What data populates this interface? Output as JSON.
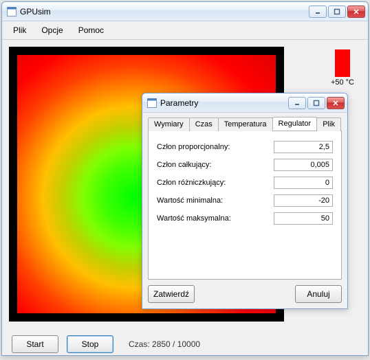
{
  "main_window": {
    "title": "GPUsim",
    "menu": {
      "file": "Plik",
      "options": "Opcje",
      "help": "Pomoc"
    },
    "legend_top": "+50 °C",
    "buttons": {
      "start": "Start",
      "stop": "Stop"
    },
    "status_prefix": "Czas: ",
    "status_value": "2850 / 10000"
  },
  "dialog": {
    "title": "Parametry",
    "tabs": {
      "dims": "Wymiary",
      "time": "Czas",
      "temp": "Temperatura",
      "reg": "Regulator",
      "file": "Plik"
    },
    "selected_tab": "reg",
    "fields": [
      {
        "label": "Człon proporcjonalny:",
        "value": "2,5"
      },
      {
        "label": "Człon całkujący:",
        "value": "0,005"
      },
      {
        "label": "Człon różniczkujący:",
        "value": "0"
      },
      {
        "label": "Wartość minimalna:",
        "value": "-20"
      },
      {
        "label": "Wartość maksymalna:",
        "value": "50"
      }
    ],
    "buttons": {
      "ok": "Zatwierdź",
      "cancel": "Anuluj"
    }
  }
}
